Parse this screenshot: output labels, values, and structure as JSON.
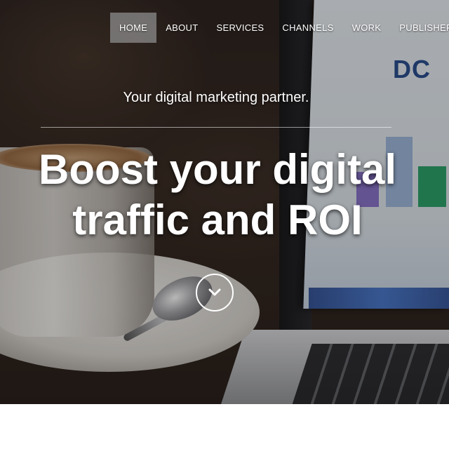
{
  "nav": {
    "items": [
      {
        "label": "HOME",
        "active": true
      },
      {
        "label": "ABOUT",
        "active": false
      },
      {
        "label": "SERVICES",
        "active": false
      },
      {
        "label": "CHANNELS",
        "active": false
      },
      {
        "label": "WORK",
        "active": false
      },
      {
        "label": "PUBLISHERS",
        "active": false
      }
    ]
  },
  "hero": {
    "tagline": "Your digital marketing partner.",
    "headline_line1": "Boost your digital",
    "headline_line2": "traffic and ROI",
    "scroll_icon": "chevron-down-icon"
  },
  "colors": {
    "nav_active_bg": "#8c8c8c",
    "text": "#ffffff",
    "page_bg": "#ffffff"
  }
}
